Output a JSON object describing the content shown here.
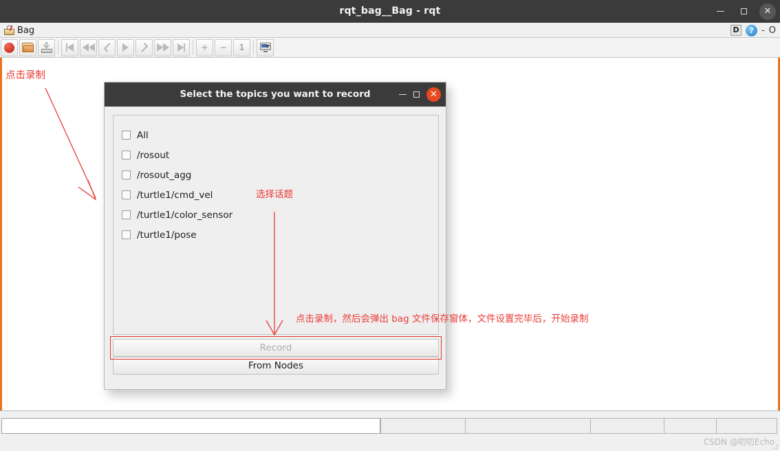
{
  "window": {
    "title": "rqt_bag__Bag - rqt",
    "controls": {
      "minimize": "–",
      "maximize": "□",
      "close": "✕"
    },
    "accent_color": "#e8731f",
    "titlebar_color": "#3b3b3b"
  },
  "plugin_bar": {
    "tab_label": "Bag",
    "tab_icon": "bag-icon",
    "dock_controls": {
      "d_label": "D",
      "help_label": "?",
      "minimize_label": "-",
      "float_label": "O"
    }
  },
  "toolbar": {
    "buttons": [
      {
        "name": "record-button",
        "icon": "record-icon",
        "enabled": true
      },
      {
        "name": "load-bag-button",
        "icon": "folder-open-icon",
        "enabled": true
      },
      {
        "name": "save-bag-button",
        "icon": "save-to-disk-icon",
        "enabled": true
      },
      {
        "name": "go-to-begin-button",
        "icon": "skip-to-start-icon",
        "enabled": false
      },
      {
        "name": "rewind-button",
        "icon": "rewind-icon",
        "enabled": false
      },
      {
        "name": "step-back-button",
        "icon": "chevron-left-icon",
        "enabled": false
      },
      {
        "name": "play-button",
        "icon": "play-icon",
        "enabled": false
      },
      {
        "name": "step-forward-button",
        "icon": "chevron-right-icon",
        "enabled": false
      },
      {
        "name": "fast-forward-button",
        "icon": "fast-forward-icon",
        "enabled": false
      },
      {
        "name": "go-to-end-button",
        "icon": "skip-to-end-icon",
        "enabled": false
      },
      {
        "name": "zoom-in-button",
        "icon": "zoom-in-icon",
        "enabled": false
      },
      {
        "name": "zoom-out-button",
        "icon": "zoom-out-icon",
        "enabled": false
      },
      {
        "name": "zoom-reset-button",
        "icon": "zoom-reset-one-icon",
        "enabled": false
      },
      {
        "name": "thumbnail-toggle-button",
        "icon": "thumbnail-icon",
        "enabled": true
      }
    ],
    "zoom_reset_label": "1",
    "zoom_in_label": "+",
    "zoom_out_label": "−"
  },
  "dialog": {
    "title": "Select the topics you want to record",
    "controls": {
      "minimize": "–",
      "maximize": "□",
      "close": "✕"
    },
    "close_color": "#e8491f",
    "topics": [
      {
        "label": "All",
        "checked": false
      },
      {
        "label": "/rosout",
        "checked": false
      },
      {
        "label": "/rosout_agg",
        "checked": false
      },
      {
        "label": "/turtle1/cmd_vel",
        "checked": false
      },
      {
        "label": "/turtle1/color_sensor",
        "checked": false
      },
      {
        "label": "/turtle1/pose",
        "checked": false
      }
    ],
    "record_button": {
      "label": "Record",
      "enabled": false
    },
    "from_nodes_button": {
      "label": "From Nodes",
      "enabled": true
    }
  },
  "annotations": {
    "color": "#ea3b34",
    "click_record_toolbar": "点击录制",
    "select_topic": "选择话题",
    "record_flow": "点击录制，然后会弹出 bag 文件保存窗体，文件设置完毕后，开始录制"
  },
  "status_bar": {
    "field_value": "",
    "panels": [
      "",
      "",
      "",
      "",
      ""
    ],
    "watermark": "CSDN @叨叨Echo"
  }
}
